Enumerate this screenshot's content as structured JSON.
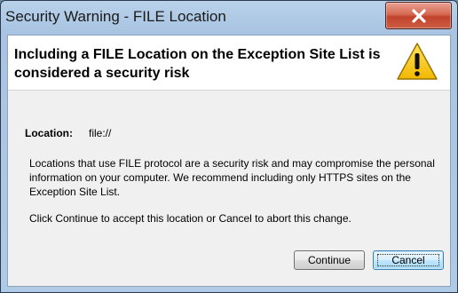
{
  "window": {
    "title": "Security Warning - FILE Location",
    "close_icon": "close-icon"
  },
  "header": {
    "headline": "Including a FILE Location on the Exception Site List is considered a security risk",
    "icon": "warning-icon",
    "icon_color": "#f5c400"
  },
  "location": {
    "label": "Location:",
    "value": "file://"
  },
  "body": {
    "paragraph1": "Locations that use FILE protocol are a security risk and may compromise the personal information on your computer.  We recommend including only HTTPS sites on the Exception Site List.",
    "paragraph2": "Click Continue to accept this location or Cancel to abort this change."
  },
  "buttons": {
    "continue_label": "Continue",
    "cancel_label": "Cancel"
  }
}
